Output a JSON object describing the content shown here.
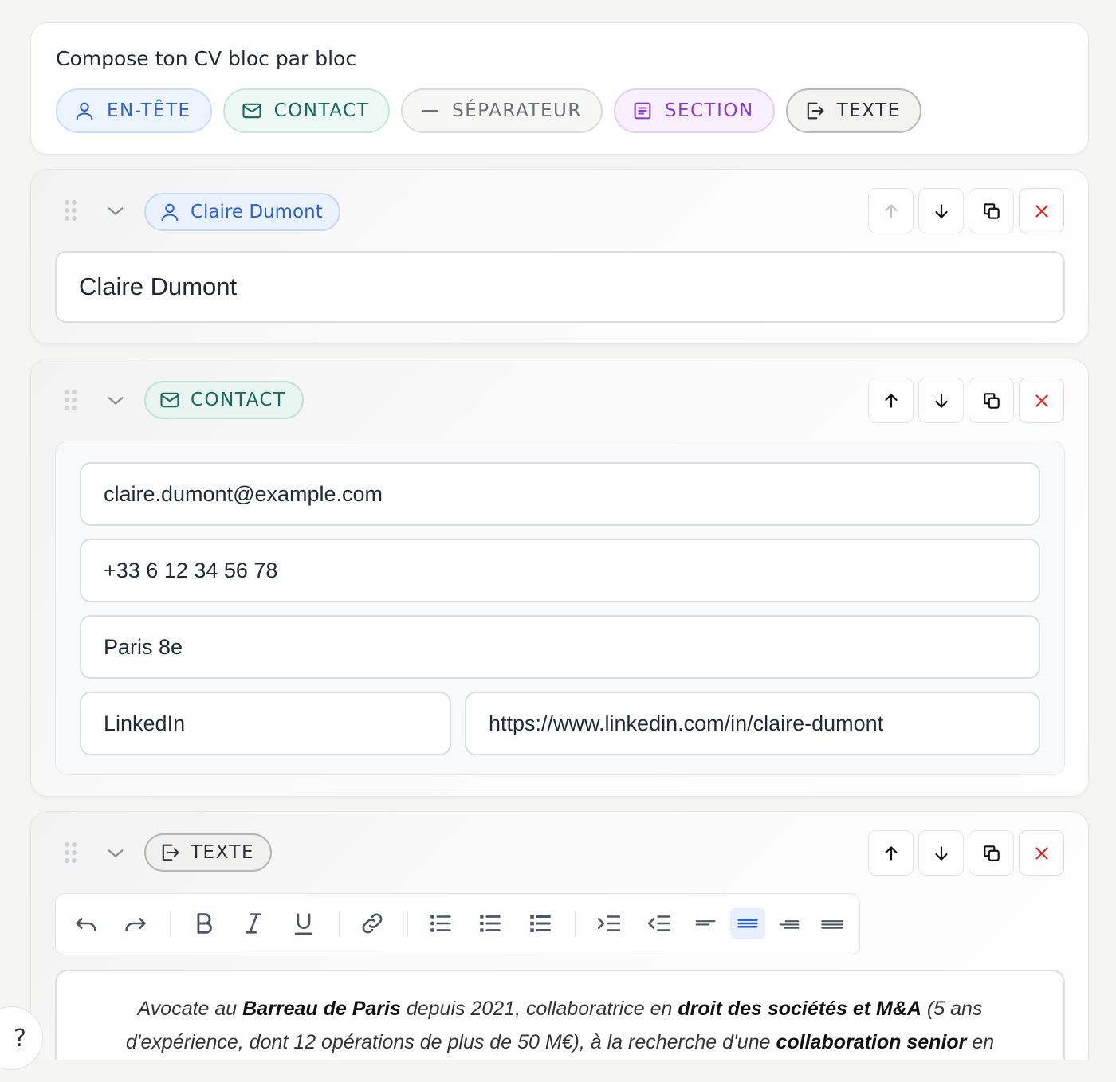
{
  "composer": {
    "title": "Compose ton CV bloc par bloc",
    "chips": [
      {
        "label": "EN-TÊTE",
        "icon": "user-icon",
        "color": "#2f63cf"
      },
      {
        "label": "CONTACT",
        "icon": "mail-icon",
        "color": "#17695a"
      },
      {
        "label": "SÉPARATEUR",
        "icon": "dash-icon",
        "color": "#6b6f76"
      },
      {
        "label": "SECTION",
        "icon": "document-icon",
        "color": "#8b3fd1"
      },
      {
        "label": "TEXTE",
        "icon": "export-icon",
        "color": "#2b2f36"
      }
    ]
  },
  "header_block": {
    "tag": "Claire Dumont",
    "name_value": "Claire Dumont"
  },
  "contact_block": {
    "tag": "CONTACT",
    "email": "claire.dumont@example.com",
    "phone": "+33 6 12 34 56 78",
    "location": "Paris 8e",
    "link_label": "LinkedIn",
    "link_url": "https://www.linkedin.com/in/claire-dumont"
  },
  "text_block": {
    "tag": "TEXTE",
    "content": {
      "p1": "Avocate au ",
      "b1": "Barreau de Paris",
      "p2": " depuis 2021, collaboratrice en ",
      "b2": "droit des sociétés et M&A",
      "p3": " (5 ans d'expérience, dont 12 opérations de plus de 50 M€), à la recherche d'une ",
      "b3": "collaboration senior",
      "p4": " en"
    }
  },
  "help": {
    "label": "?"
  }
}
